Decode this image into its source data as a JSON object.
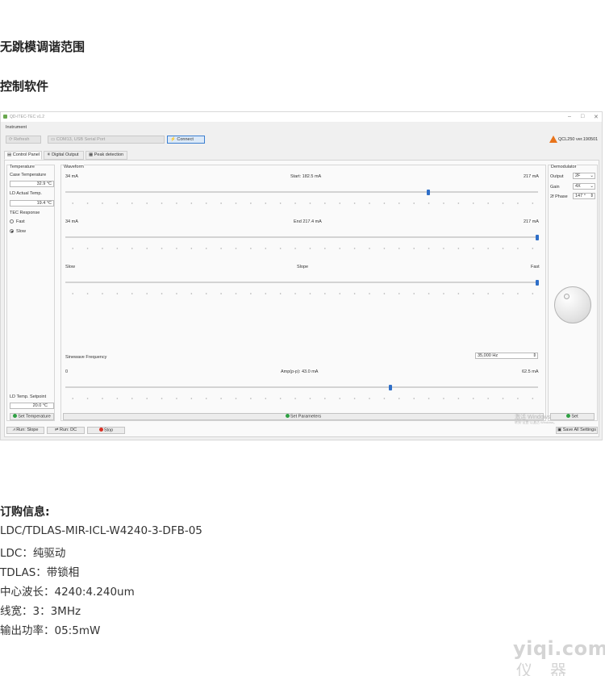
{
  "headings": {
    "mode_hop_free": "无跳模调谐范围",
    "control_software": "控制软件"
  },
  "app": {
    "window_title": "QD-ITEC-TEC v1.2",
    "instrument_label": "Instrument",
    "refresh_label": "Refresh",
    "port_value": "COM13, USB Serial Port",
    "connect_label": "Connect",
    "version": "QCL250 ver.190501",
    "tabs": [
      "Control Panel",
      "Digital Output",
      "Peak detection"
    ],
    "temperature": {
      "title": "Temperature",
      "case_label": "Case Temperature",
      "case_value": "32.9 °C",
      "ld_label": "LD Actual Temp.",
      "ld_value": "19.4 °C",
      "tec_label": "TEC Response",
      "fast": "Fast",
      "slow": "Slow",
      "tec_selected": "Slow",
      "setpoint_label": "LD Temp. Setpoint",
      "setpoint_value": "20.0 °C",
      "set_temp_button": "Set Temperature"
    },
    "waveform": {
      "title": "Waveform",
      "start": {
        "min": "34 mA",
        "label": "Start:  182.5 mA",
        "max": "217 mA",
        "fraction": 0.77
      },
      "end": {
        "min": "34 mA",
        "label": "End  217.4 mA",
        "max": "217 mA",
        "fraction": 1.0
      },
      "slope": {
        "min": "Slow",
        "label": "Slope",
        "max": "Fast",
        "fraction": 1.0
      },
      "sine_label": "Sinewave Frequency",
      "sine_value": "35,000 Hz",
      "amp": {
        "min": "0",
        "label": "Amp(p-p):  43.0 mA",
        "max": "62.5 mA",
        "fraction": 0.69
      },
      "set_params_button": "Set Parameters"
    },
    "demodulator": {
      "title": "Demodulator",
      "output_label": "Output",
      "output_value": "2F",
      "gain_label": "Gain",
      "gain_value": "4X",
      "phase_label": "2f Phase",
      "phase_value": "147 °",
      "set_button": "Set"
    },
    "activate_windows": "激活 Windows",
    "activate_windows_sub": "转到\"设置\"以激活 Windows。",
    "bottom": {
      "run_slope": "Run: Slope",
      "run_dc": "Run: DC",
      "stop": "Stop",
      "save_all": "Save All Settings"
    }
  },
  "order": {
    "title": "订购信息:",
    "lines": [
      "LDC/TDLAS-MIR-ICL-W4240-3-DFB-05",
      "LDC：纯驱动",
      "TDLAS：带锁相",
      "中心波长：4240:4.240um",
      "线宽：3：3MHz",
      "输出功率：05:5mW"
    ]
  },
  "site_watermark": "yiqi.com",
  "site_watermark_cn": "仪器网"
}
